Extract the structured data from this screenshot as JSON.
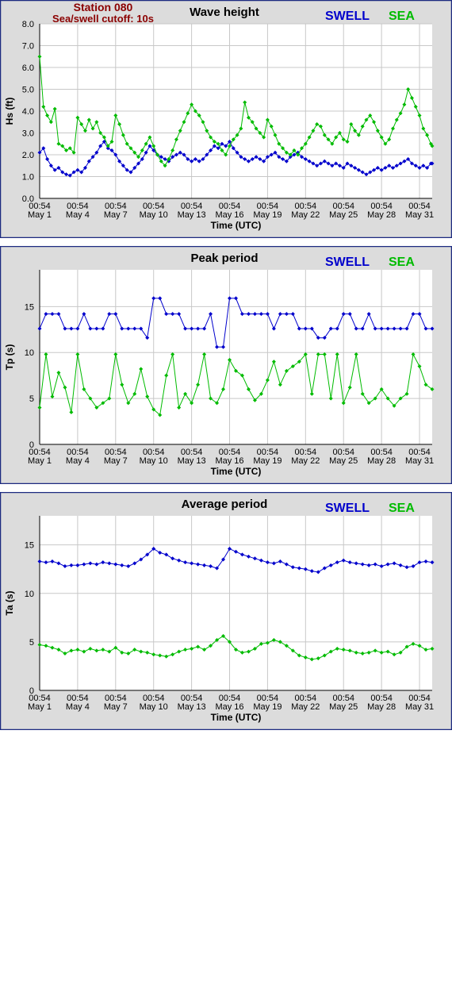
{
  "header": {
    "station": "Station 080",
    "cutoff": "Sea/swell cutoff: 10s"
  },
  "colors": {
    "swell": "#0000cc",
    "sea": "#00bb00",
    "panel_bg": "#dcdcdc",
    "frame": "#1c2a80",
    "grid": "#c8c8c8"
  },
  "x_axis": {
    "label": "Time (UTC)",
    "ticks": [
      {
        "time": "00:54",
        "date": "May 1",
        "day": 0
      },
      {
        "time": "00:54",
        "date": "May 4",
        "day": 3
      },
      {
        "time": "00:54",
        "date": "May 7",
        "day": 6
      },
      {
        "time": "00:54",
        "date": "May 10",
        "day": 9
      },
      {
        "time": "00:54",
        "date": "May 13",
        "day": 12
      },
      {
        "time": "00:54",
        "date": "May 16",
        "day": 15
      },
      {
        "time": "00:54",
        "date": "May 19",
        "day": 18
      },
      {
        "time": "00:54",
        "date": "May 22",
        "day": 21
      },
      {
        "time": "00:54",
        "date": "May 25",
        "day": 24
      },
      {
        "time": "00:54",
        "date": "May 28",
        "day": 27
      },
      {
        "time": "00:54",
        "date": "May 31",
        "day": 30
      }
    ],
    "xlim": [
      0,
      31
    ]
  },
  "chart_data": [
    {
      "type": "line",
      "title": "Wave height",
      "ylabel": "Hs (ft)",
      "ylim": [
        0,
        8
      ],
      "yticks": [
        "0.0",
        "1.0",
        "2.0",
        "3.0",
        "4.0",
        "5.0",
        "6.0",
        "7.0",
        "8.0"
      ],
      "legend": [
        "SWELL",
        "SEA"
      ],
      "grid": true,
      "series": [
        {
          "name": "SWELL",
          "color": "#0000cc",
          "x": [
            0,
            0.3,
            0.6,
            0.9,
            1.2,
            1.5,
            1.8,
            2.1,
            2.4,
            2.7,
            3.0,
            3.3,
            3.6,
            3.9,
            4.2,
            4.5,
            4.8,
            5.1,
            5.4,
            5.7,
            6.0,
            6.3,
            6.6,
            6.9,
            7.2,
            7.5,
            7.8,
            8.1,
            8.4,
            8.7,
            9.0,
            9.3,
            9.6,
            9.9,
            10.2,
            10.5,
            10.8,
            11.1,
            11.4,
            11.7,
            12.0,
            12.3,
            12.6,
            12.9,
            13.2,
            13.5,
            13.8,
            14.1,
            14.4,
            14.7,
            15.0,
            15.3,
            15.6,
            15.9,
            16.2,
            16.5,
            16.8,
            17.1,
            17.4,
            17.7,
            18.0,
            18.3,
            18.6,
            18.9,
            19.2,
            19.5,
            19.8,
            20.1,
            20.4,
            20.7,
            21.0,
            21.3,
            21.6,
            21.9,
            22.2,
            22.5,
            22.8,
            23.1,
            23.4,
            23.7,
            24.0,
            24.3,
            24.6,
            24.9,
            25.2,
            25.5,
            25.8,
            26.1,
            26.4,
            26.7,
            27.0,
            27.3,
            27.6,
            27.9,
            28.2,
            28.5,
            28.8,
            29.1,
            29.4,
            29.7,
            30.0,
            30.3,
            30.6,
            30.9,
            31.0
          ],
          "y": [
            2.1,
            2.3,
            1.8,
            1.5,
            1.3,
            1.4,
            1.2,
            1.1,
            1.05,
            1.2,
            1.3,
            1.2,
            1.4,
            1.7,
            1.9,
            2.1,
            2.4,
            2.6,
            2.3,
            2.2,
            2.0,
            1.7,
            1.5,
            1.3,
            1.2,
            1.4,
            1.6,
            1.8,
            2.1,
            2.4,
            2.2,
            2.0,
            1.9,
            1.8,
            1.7,
            1.9,
            2.0,
            2.1,
            2.0,
            1.8,
            1.7,
            1.8,
            1.7,
            1.8,
            2.0,
            2.2,
            2.4,
            2.3,
            2.5,
            2.4,
            2.6,
            2.3,
            2.1,
            1.9,
            1.8,
            1.7,
            1.8,
            1.9,
            1.8,
            1.7,
            1.9,
            2.0,
            2.1,
            1.9,
            1.8,
            1.7,
            1.9,
            2.0,
            2.1,
            1.9,
            1.8,
            1.7,
            1.6,
            1.5,
            1.6,
            1.7,
            1.6,
            1.5,
            1.6,
            1.5,
            1.4,
            1.6,
            1.5,
            1.4,
            1.3,
            1.2,
            1.1,
            1.2,
            1.3,
            1.4,
            1.3,
            1.4,
            1.5,
            1.4,
            1.5,
            1.6,
            1.7,
            1.8,
            1.6,
            1.5,
            1.4,
            1.5,
            1.4,
            1.6,
            1.6
          ]
        },
        {
          "name": "SEA",
          "color": "#00bb00",
          "x": [
            0,
            0.3,
            0.6,
            0.9,
            1.2,
            1.5,
            1.8,
            2.1,
            2.4,
            2.7,
            3.0,
            3.3,
            3.6,
            3.9,
            4.2,
            4.5,
            4.8,
            5.1,
            5.4,
            5.7,
            6.0,
            6.3,
            6.6,
            6.9,
            7.2,
            7.5,
            7.8,
            8.1,
            8.4,
            8.7,
            9.0,
            9.3,
            9.6,
            9.9,
            10.2,
            10.5,
            10.8,
            11.1,
            11.4,
            11.7,
            12.0,
            12.3,
            12.6,
            12.9,
            13.2,
            13.5,
            13.8,
            14.1,
            14.4,
            14.7,
            15.0,
            15.3,
            15.6,
            15.9,
            16.2,
            16.5,
            16.8,
            17.1,
            17.4,
            17.7,
            18.0,
            18.3,
            18.6,
            18.9,
            19.2,
            19.5,
            19.8,
            20.1,
            20.4,
            20.7,
            21.0,
            21.3,
            21.6,
            21.9,
            22.2,
            22.5,
            22.8,
            23.1,
            23.4,
            23.7,
            24.0,
            24.3,
            24.6,
            24.9,
            25.2,
            25.5,
            25.8,
            26.1,
            26.4,
            26.7,
            27.0,
            27.3,
            27.6,
            27.9,
            28.2,
            28.5,
            28.8,
            29.1,
            29.4,
            29.7,
            30.0,
            30.3,
            30.6,
            30.9,
            31.0
          ],
          "y": [
            6.5,
            4.2,
            3.8,
            3.5,
            4.1,
            2.5,
            2.4,
            2.2,
            2.3,
            2.1,
            3.7,
            3.4,
            3.1,
            3.6,
            3.2,
            3.5,
            3.0,
            2.8,
            2.4,
            2.6,
            3.8,
            3.4,
            2.9,
            2.5,
            2.3,
            2.1,
            1.9,
            2.2,
            2.5,
            2.8,
            2.4,
            2.0,
            1.7,
            1.5,
            1.8,
            2.2,
            2.7,
            3.1,
            3.5,
            3.9,
            4.3,
            4.0,
            3.8,
            3.5,
            3.1,
            2.8,
            2.6,
            2.5,
            2.2,
            2.0,
            2.4,
            2.7,
            2.9,
            3.2,
            4.4,
            3.7,
            3.5,
            3.2,
            3.0,
            2.8,
            3.6,
            3.3,
            2.9,
            2.5,
            2.3,
            2.1,
            2.0,
            2.2,
            2.0,
            2.3,
            2.5,
            2.8,
            3.1,
            3.4,
            3.3,
            2.9,
            2.7,
            2.5,
            2.8,
            3.0,
            2.7,
            2.6,
            3.4,
            3.1,
            2.9,
            3.3,
            3.6,
            3.8,
            3.5,
            3.1,
            2.8,
            2.5,
            2.7,
            3.2,
            3.6,
            3.9,
            4.3,
            5.0,
            4.6,
            4.2,
            3.8,
            3.2,
            2.9,
            2.5,
            2.4
          ]
        }
      ]
    },
    {
      "type": "line",
      "title": "Peak period",
      "ylabel": "Tp (s)",
      "ylim": [
        0,
        19
      ],
      "yticks": [
        "0",
        "5",
        "10",
        "15"
      ],
      "legend": [
        "SWELL",
        "SEA"
      ],
      "grid": true,
      "series": [
        {
          "name": "SWELL",
          "color": "#0000cc",
          "x": [
            0,
            0.5,
            1.0,
            1.5,
            2.0,
            2.5,
            3.0,
            3.5,
            4.0,
            4.5,
            5.0,
            5.5,
            6.0,
            6.5,
            7.0,
            7.5,
            8.0,
            8.5,
            9.0,
            9.5,
            10.0,
            10.5,
            11.0,
            11.5,
            12.0,
            12.5,
            13.0,
            13.5,
            14.0,
            14.5,
            15.0,
            15.5,
            16.0,
            16.5,
            17.0,
            17.5,
            18.0,
            18.5,
            19.0,
            19.5,
            20.0,
            20.5,
            21.0,
            21.5,
            22.0,
            22.5,
            23.0,
            23.5,
            24.0,
            24.5,
            25.0,
            25.5,
            26.0,
            26.5,
            27.0,
            27.5,
            28.0,
            28.5,
            29.0,
            29.5,
            30.0,
            30.5,
            31.0
          ],
          "y": [
            12.6,
            14.2,
            14.2,
            14.2,
            12.6,
            12.6,
            12.6,
            14.2,
            12.6,
            12.6,
            12.6,
            14.2,
            14.2,
            12.6,
            12.6,
            12.6,
            12.6,
            11.6,
            15.9,
            15.9,
            14.2,
            14.2,
            14.2,
            12.6,
            12.6,
            12.6,
            12.6,
            14.2,
            10.6,
            10.6,
            15.9,
            15.9,
            14.2,
            14.2,
            14.2,
            14.2,
            14.2,
            12.6,
            14.2,
            14.2,
            14.2,
            12.6,
            12.6,
            12.6,
            11.6,
            11.6,
            12.6,
            12.6,
            14.2,
            14.2,
            12.6,
            12.6,
            14.2,
            12.6,
            12.6,
            12.6,
            12.6,
            12.6,
            12.6,
            14.2,
            14.2,
            12.6,
            12.6
          ]
        },
        {
          "name": "SEA",
          "color": "#00bb00",
          "x": [
            0,
            0.5,
            1.0,
            1.5,
            2.0,
            2.5,
            3.0,
            3.5,
            4.0,
            4.5,
            5.0,
            5.5,
            6.0,
            6.5,
            7.0,
            7.5,
            8.0,
            8.5,
            9.0,
            9.5,
            10.0,
            10.5,
            11.0,
            11.5,
            12.0,
            12.5,
            13.0,
            13.5,
            14.0,
            14.5,
            15.0,
            15.5,
            16.0,
            16.5,
            17.0,
            17.5,
            18.0,
            18.5,
            19.0,
            19.5,
            20.0,
            20.5,
            21.0,
            21.5,
            22.0,
            22.5,
            23.0,
            23.5,
            24.0,
            24.5,
            25.0,
            25.5,
            26.0,
            26.5,
            27.0,
            27.5,
            28.0,
            28.5,
            29.0,
            29.5,
            30.0,
            30.5,
            31.0
          ],
          "y": [
            4.0,
            9.8,
            5.2,
            7.8,
            6.2,
            3.5,
            9.8,
            6.0,
            5.0,
            4.0,
            4.5,
            5.0,
            9.8,
            6.5,
            4.5,
            5.5,
            8.2,
            5.2,
            3.8,
            3.2,
            7.5,
            9.8,
            4.0,
            5.5,
            4.5,
            6.5,
            9.8,
            5.0,
            4.5,
            6.0,
            9.2,
            8.0,
            7.5,
            6.0,
            4.8,
            5.5,
            7.0,
            9.0,
            6.5,
            8.0,
            8.5,
            9.0,
            9.8,
            5.5,
            9.8,
            9.8,
            5.0,
            9.8,
            4.5,
            6.2,
            9.8,
            5.5,
            4.5,
            5.0,
            6.0,
            5.0,
            4.2,
            5.0,
            5.5,
            9.8,
            8.5,
            6.5,
            6.0
          ]
        }
      ]
    },
    {
      "type": "line",
      "title": "Average period",
      "ylabel": "Ta (s)",
      "ylim": [
        0,
        18
      ],
      "yticks": [
        "0",
        "5",
        "10",
        "15"
      ],
      "legend": [
        "SWELL",
        "SEA"
      ],
      "grid": true,
      "series": [
        {
          "name": "SWELL",
          "color": "#0000cc",
          "x": [
            0,
            0.5,
            1.0,
            1.5,
            2.0,
            2.5,
            3.0,
            3.5,
            4.0,
            4.5,
            5.0,
            5.5,
            6.0,
            6.5,
            7.0,
            7.5,
            8.0,
            8.5,
            9.0,
            9.5,
            10.0,
            10.5,
            11.0,
            11.5,
            12.0,
            12.5,
            13.0,
            13.5,
            14.0,
            14.5,
            15.0,
            15.5,
            16.0,
            16.5,
            17.0,
            17.5,
            18.0,
            18.5,
            19.0,
            19.5,
            20.0,
            20.5,
            21.0,
            21.5,
            22.0,
            22.5,
            23.0,
            23.5,
            24.0,
            24.5,
            25.0,
            25.5,
            26.0,
            26.5,
            27.0,
            27.5,
            28.0,
            28.5,
            29.0,
            29.5,
            30.0,
            30.5,
            31.0
          ],
          "y": [
            13.3,
            13.2,
            13.3,
            13.1,
            12.8,
            12.9,
            12.9,
            13.0,
            13.1,
            13.0,
            13.2,
            13.1,
            13.0,
            12.9,
            12.8,
            13.1,
            13.5,
            14.0,
            14.6,
            14.2,
            14.0,
            13.6,
            13.4,
            13.2,
            13.1,
            13.0,
            12.9,
            12.8,
            12.6,
            13.5,
            14.6,
            14.3,
            14.0,
            13.8,
            13.6,
            13.4,
            13.2,
            13.1,
            13.3,
            13.0,
            12.7,
            12.6,
            12.5,
            12.3,
            12.2,
            12.6,
            12.9,
            13.2,
            13.4,
            13.2,
            13.1,
            13.0,
            12.9,
            13.0,
            12.8,
            13.0,
            13.1,
            12.9,
            12.7,
            12.8,
            13.2,
            13.3,
            13.2
          ]
        },
        {
          "name": "SEA",
          "color": "#00bb00",
          "x": [
            0,
            0.5,
            1.0,
            1.5,
            2.0,
            2.5,
            3.0,
            3.5,
            4.0,
            4.5,
            5.0,
            5.5,
            6.0,
            6.5,
            7.0,
            7.5,
            8.0,
            8.5,
            9.0,
            9.5,
            10.0,
            10.5,
            11.0,
            11.5,
            12.0,
            12.5,
            13.0,
            13.5,
            14.0,
            14.5,
            15.0,
            15.5,
            16.0,
            16.5,
            17.0,
            17.5,
            18.0,
            18.5,
            19.0,
            19.5,
            20.0,
            20.5,
            21.0,
            21.5,
            22.0,
            22.5,
            23.0,
            23.5,
            24.0,
            24.5,
            25.0,
            25.5,
            26.0,
            26.5,
            27.0,
            27.5,
            28.0,
            28.5,
            29.0,
            29.5,
            30.0,
            30.5,
            31.0
          ],
          "y": [
            4.7,
            4.6,
            4.4,
            4.2,
            3.8,
            4.1,
            4.2,
            4.0,
            4.3,
            4.1,
            4.2,
            4.0,
            4.4,
            3.9,
            3.8,
            4.2,
            4.0,
            3.9,
            3.7,
            3.6,
            3.5,
            3.7,
            4.0,
            4.2,
            4.3,
            4.5,
            4.2,
            4.6,
            5.2,
            5.6,
            5.0,
            4.2,
            3.9,
            4.0,
            4.3,
            4.8,
            4.9,
            5.2,
            5.0,
            4.6,
            4.1,
            3.6,
            3.4,
            3.2,
            3.3,
            3.6,
            4.0,
            4.3,
            4.2,
            4.1,
            3.9,
            3.8,
            3.9,
            4.1,
            3.9,
            4.0,
            3.7,
            3.9,
            4.5,
            4.8,
            4.6,
            4.2,
            4.3
          ]
        }
      ]
    }
  ]
}
